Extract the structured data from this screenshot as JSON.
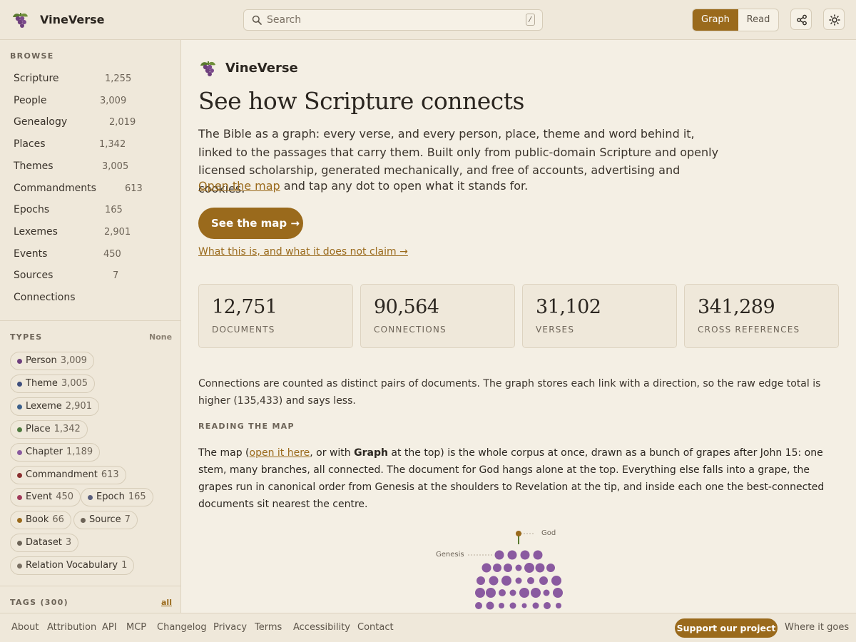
{
  "header": {
    "app_title": "VineVerse",
    "search_placeholder": "Search",
    "search_shortcut": "/",
    "view_graph": "Graph",
    "view_read": "Read",
    "active_view": "Graph"
  },
  "sidebar": {
    "browse_label": "BROWSE",
    "browse": [
      {
        "label": "Scripture",
        "count": "1,255"
      },
      {
        "label": "People",
        "count": "3,009"
      },
      {
        "label": "Genealogy",
        "count": "2,019"
      },
      {
        "label": "Places",
        "count": "1,342"
      },
      {
        "label": "Themes",
        "count": "3,005"
      },
      {
        "label": "Commandments",
        "count": "613"
      },
      {
        "label": "Epochs",
        "count": "165"
      },
      {
        "label": "Lexemes",
        "count": "2,901"
      },
      {
        "label": "Events",
        "count": "450"
      },
      {
        "label": "Sources",
        "count": "7"
      },
      {
        "label": "Connections",
        "count": ""
      }
    ],
    "types_label": "TYPES",
    "types_none": "None",
    "types": [
      {
        "label": "Person",
        "count": "3,009",
        "color": "#6e3f7d"
      },
      {
        "label": "Theme",
        "count": "3,005",
        "color": "#3f4f7d"
      },
      {
        "label": "Lexeme",
        "count": "2,901",
        "color": "#3b5f8a"
      },
      {
        "label": "Place",
        "count": "1,342",
        "color": "#4f7a3f"
      },
      {
        "label": "Chapter",
        "count": "1,189",
        "color": "#8a5aa0"
      },
      {
        "label": "Commandment",
        "count": "613",
        "color": "#8a2f2f"
      },
      {
        "label": "Event",
        "count": "450",
        "color": "#a03a5a"
      },
      {
        "label": "Epoch",
        "count": "165",
        "color": "#5a5f7d"
      },
      {
        "label": "Book",
        "count": "66",
        "color": "#9a6a1c"
      },
      {
        "label": "Source",
        "count": "7",
        "color": "#6d6458"
      },
      {
        "label": "Dataset",
        "count": "3",
        "color": "#6d6458"
      },
      {
        "label": "Relation Vocabulary",
        "count": "1",
        "color": "#7a7063"
      }
    ],
    "tags_label": "TAGS (300)",
    "tags_all": "all"
  },
  "main": {
    "brand": "VineVerse",
    "title": "See how Scripture connects",
    "intro": "The Bible as a graph: every verse, and every person, place, theme and word behind it, linked to the passages that carry them. Built only from public-domain Scripture and openly licensed scholarship, generated mechanically, and free of accounts, advertising and cookies.",
    "open_map_link": "Open the map",
    "open_map_rest": " and tap any dot to open what it stands for.",
    "cta": "See the map →",
    "claim_link": "What this is, and what it does not claim →",
    "stats": [
      {
        "value": "12,751",
        "label": "DOCUMENTS"
      },
      {
        "value": "90,564",
        "label": "CONNECTIONS"
      },
      {
        "value": "31,102",
        "label": "VERSES"
      },
      {
        "value": "341,289",
        "label": "CROSS REFERENCES"
      }
    ],
    "note": "Connections are counted as distinct pairs of documents. The graph stores each link with a direction, so the raw edge total is higher (135,433) and says less.",
    "reading_label": "READING THE MAP",
    "reading_p1": "The map (",
    "reading_link": "open it here",
    "reading_p2": ", or with ",
    "reading_bold": "Graph",
    "reading_p3": " at the top) is the whole corpus at once, drawn as a bunch of grapes after John 15: one stem, many branches, all connected. The document for God hangs alone at the top. Everything else falls into a grape, the grapes run in canonical order from Genesis at the shoulders to Revelation at the tip, and inside each one the best-connected documents sit nearest the centre.",
    "figure_god": "God",
    "figure_genesis": "Genesis"
  },
  "footer": {
    "links": [
      "About",
      "Attribution",
      "API",
      "MCP",
      "Changelog",
      "Privacy",
      "Terms",
      "Accessibility",
      "Contact"
    ],
    "support": "Support our project",
    "where": "Where it goes"
  },
  "colors": {
    "accent": "#9a6a1c",
    "background": "#f4efe4",
    "panel": "#efe8da",
    "grape": "#8a5aa0"
  }
}
